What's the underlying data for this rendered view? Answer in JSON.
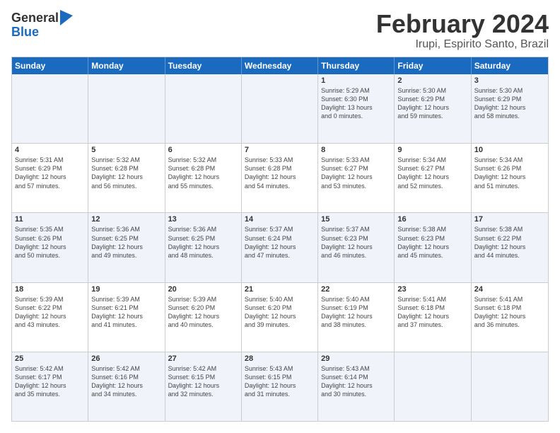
{
  "logo": {
    "general": "General",
    "blue": "Blue"
  },
  "title": {
    "month": "February 2024",
    "location": "Irupi, Espirito Santo, Brazil"
  },
  "header_days": [
    "Sunday",
    "Monday",
    "Tuesday",
    "Wednesday",
    "Thursday",
    "Friday",
    "Saturday"
  ],
  "rows": [
    [
      {
        "date": "",
        "info": "",
        "empty": true
      },
      {
        "date": "",
        "info": "",
        "empty": true
      },
      {
        "date": "",
        "info": "",
        "empty": true
      },
      {
        "date": "",
        "info": "",
        "empty": true
      },
      {
        "date": "1",
        "info": "Sunrise: 5:29 AM\nSunset: 6:30 PM\nDaylight: 13 hours\nand 0 minutes.",
        "empty": false
      },
      {
        "date": "2",
        "info": "Sunrise: 5:30 AM\nSunset: 6:29 PM\nDaylight: 12 hours\nand 59 minutes.",
        "empty": false
      },
      {
        "date": "3",
        "info": "Sunrise: 5:30 AM\nSunset: 6:29 PM\nDaylight: 12 hours\nand 58 minutes.",
        "empty": false
      }
    ],
    [
      {
        "date": "4",
        "info": "Sunrise: 5:31 AM\nSunset: 6:29 PM\nDaylight: 12 hours\nand 57 minutes.",
        "empty": false
      },
      {
        "date": "5",
        "info": "Sunrise: 5:32 AM\nSunset: 6:28 PM\nDaylight: 12 hours\nand 56 minutes.",
        "empty": false
      },
      {
        "date": "6",
        "info": "Sunrise: 5:32 AM\nSunset: 6:28 PM\nDaylight: 12 hours\nand 55 minutes.",
        "empty": false
      },
      {
        "date": "7",
        "info": "Sunrise: 5:33 AM\nSunset: 6:28 PM\nDaylight: 12 hours\nand 54 minutes.",
        "empty": false
      },
      {
        "date": "8",
        "info": "Sunrise: 5:33 AM\nSunset: 6:27 PM\nDaylight: 12 hours\nand 53 minutes.",
        "empty": false
      },
      {
        "date": "9",
        "info": "Sunrise: 5:34 AM\nSunset: 6:27 PM\nDaylight: 12 hours\nand 52 minutes.",
        "empty": false
      },
      {
        "date": "10",
        "info": "Sunrise: 5:34 AM\nSunset: 6:26 PM\nDaylight: 12 hours\nand 51 minutes.",
        "empty": false
      }
    ],
    [
      {
        "date": "11",
        "info": "Sunrise: 5:35 AM\nSunset: 6:26 PM\nDaylight: 12 hours\nand 50 minutes.",
        "empty": false
      },
      {
        "date": "12",
        "info": "Sunrise: 5:36 AM\nSunset: 6:25 PM\nDaylight: 12 hours\nand 49 minutes.",
        "empty": false
      },
      {
        "date": "13",
        "info": "Sunrise: 5:36 AM\nSunset: 6:25 PM\nDaylight: 12 hours\nand 48 minutes.",
        "empty": false
      },
      {
        "date": "14",
        "info": "Sunrise: 5:37 AM\nSunset: 6:24 PM\nDaylight: 12 hours\nand 47 minutes.",
        "empty": false
      },
      {
        "date": "15",
        "info": "Sunrise: 5:37 AM\nSunset: 6:23 PM\nDaylight: 12 hours\nand 46 minutes.",
        "empty": false
      },
      {
        "date": "16",
        "info": "Sunrise: 5:38 AM\nSunset: 6:23 PM\nDaylight: 12 hours\nand 45 minutes.",
        "empty": false
      },
      {
        "date": "17",
        "info": "Sunrise: 5:38 AM\nSunset: 6:22 PM\nDaylight: 12 hours\nand 44 minutes.",
        "empty": false
      }
    ],
    [
      {
        "date": "18",
        "info": "Sunrise: 5:39 AM\nSunset: 6:22 PM\nDaylight: 12 hours\nand 43 minutes.",
        "empty": false
      },
      {
        "date": "19",
        "info": "Sunrise: 5:39 AM\nSunset: 6:21 PM\nDaylight: 12 hours\nand 41 minutes.",
        "empty": false
      },
      {
        "date": "20",
        "info": "Sunrise: 5:39 AM\nSunset: 6:20 PM\nDaylight: 12 hours\nand 40 minutes.",
        "empty": false
      },
      {
        "date": "21",
        "info": "Sunrise: 5:40 AM\nSunset: 6:20 PM\nDaylight: 12 hours\nand 39 minutes.",
        "empty": false
      },
      {
        "date": "22",
        "info": "Sunrise: 5:40 AM\nSunset: 6:19 PM\nDaylight: 12 hours\nand 38 minutes.",
        "empty": false
      },
      {
        "date": "23",
        "info": "Sunrise: 5:41 AM\nSunset: 6:18 PM\nDaylight: 12 hours\nand 37 minutes.",
        "empty": false
      },
      {
        "date": "24",
        "info": "Sunrise: 5:41 AM\nSunset: 6:18 PM\nDaylight: 12 hours\nand 36 minutes.",
        "empty": false
      }
    ],
    [
      {
        "date": "25",
        "info": "Sunrise: 5:42 AM\nSunset: 6:17 PM\nDaylight: 12 hours\nand 35 minutes.",
        "empty": false
      },
      {
        "date": "26",
        "info": "Sunrise: 5:42 AM\nSunset: 6:16 PM\nDaylight: 12 hours\nand 34 minutes.",
        "empty": false
      },
      {
        "date": "27",
        "info": "Sunrise: 5:42 AM\nSunset: 6:15 PM\nDaylight: 12 hours\nand 32 minutes.",
        "empty": false
      },
      {
        "date": "28",
        "info": "Sunrise: 5:43 AM\nSunset: 6:15 PM\nDaylight: 12 hours\nand 31 minutes.",
        "empty": false
      },
      {
        "date": "29",
        "info": "Sunrise: 5:43 AM\nSunset: 6:14 PM\nDaylight: 12 hours\nand 30 minutes.",
        "empty": false
      },
      {
        "date": "",
        "info": "",
        "empty": true
      },
      {
        "date": "",
        "info": "",
        "empty": true
      }
    ]
  ],
  "alt_rows": [
    0,
    2,
    4
  ]
}
